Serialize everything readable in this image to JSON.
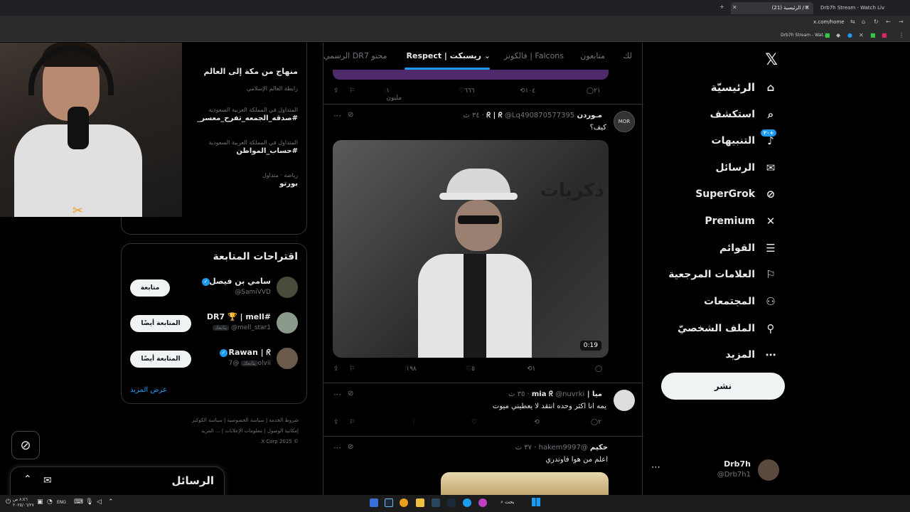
{
  "browser": {
    "tabs": [
      {
        "label": "(21) الرئيسية / X"
      },
      {
        "label": "Drb7h Stream - Watch Live on"
      }
    ],
    "url": "x.com/home",
    "bookmark": "Drb7h Stream - Wat..."
  },
  "nav": {
    "items": [
      {
        "label": "الرئيسيّة",
        "icon": "home-icon"
      },
      {
        "label": "استكشف",
        "icon": "search-icon"
      },
      {
        "label": "التنبيهات",
        "icon": "bell-icon",
        "badge": "٢٠+"
      },
      {
        "label": "الرسائل",
        "icon": "mail-icon"
      },
      {
        "label": "SuperGrok",
        "icon": "grok-icon"
      },
      {
        "label": "Premium",
        "icon": "x-logo-icon"
      },
      {
        "label": "القوائم",
        "icon": "list-icon"
      },
      {
        "label": "العلامات المرجعية",
        "icon": "bookmark-icon"
      },
      {
        "label": "المجتمعات",
        "icon": "communities-icon"
      },
      {
        "label": "الملف الشخصيّ",
        "icon": "profile-icon"
      },
      {
        "label": "المزيد",
        "icon": "more-icon"
      }
    ],
    "post_label": "نشر",
    "account": {
      "name": "Drb7h",
      "handle": "@Drb7h1"
    }
  },
  "timeline": {
    "tabs": [
      "لك",
      "متابعون",
      "فالكونز | Falcons",
      "Respect | ريسبكت",
      "الرسمي DR7 محتو"
    ],
    "top_actions": {
      "replies": "٢١",
      "reposts": "١٠٤",
      "likes": "٦٦٦",
      "views": "١ مليون"
    },
    "tweets": [
      {
        "author": "مـوردن ᖇ | ᖇ",
        "handle": "@Lq490870577395",
        "time": "٣٤ ث",
        "text": "كيف؟",
        "video_time": "0:19",
        "reposts": "١",
        "likes": "٥",
        "views": "١٩٨",
        "watermark": "ذكريات"
      },
      {
        "author": "ميا | mia ᖇ",
        "handle": "@nuvrki",
        "time": "٣٥ ث",
        "text": "يمه انا اكثر وحده انتقد لا يعطيني ميوت",
        "replies": "٢"
      },
      {
        "author": "حكيم",
        "handle": "@hakem9997",
        "time": "٣٧ ث",
        "text": "اعلم من هوا فاوندري"
      }
    ]
  },
  "sidebar": {
    "search_placeholder": "",
    "trends": [
      {
        "context": "",
        "name": "منهاج من مكة إلى العالم"
      },
      {
        "context": "رابطة العالم الإسلامي",
        "name": ""
      },
      {
        "context": "المتداول في المملكة العربية السعودية",
        "name": "#صدقه_الجمعه_تفرح_معسر_"
      },
      {
        "context": "المتداول في المملكة العربية السعودية",
        "name": "#حساب_المواطن"
      },
      {
        "context": "رياضة · متداول",
        "name": "بورتو"
      }
    ],
    "show_more": "عرض المزيد",
    "suggestions_title": "اقتراحات المتابعة",
    "suggestions": [
      {
        "name": "سامي بن فيصل",
        "handle": "@SamiVVD",
        "button": "متابعة"
      },
      {
        "name": "#DR7 🏆 | mell",
        "handle": "@mell_star1",
        "follows_you": "يتابعك",
        "button": "المتابعة أيضًا"
      },
      {
        "name": "Rawan | ᖇ",
        "handle": "@7olvii",
        "follows_you": "يتابعك",
        "button": "المتابعة أيضًا"
      }
    ],
    "footer": [
      "شروط الخدمة",
      "سياسة الخصوصية",
      "سياسة الكوكيز",
      "إمكانية الوصول",
      "معلومات الإعلانات",
      "... المزيد",
      "© 2025 X Corp."
    ]
  },
  "messages_drawer": {
    "title": "الرسائل"
  },
  "taskbar": {
    "time": "٨:٤٦ ص",
    "date": "٢٠٢٥/٠٦/٢٧",
    "lang": "ENG",
    "search": "بحث"
  }
}
